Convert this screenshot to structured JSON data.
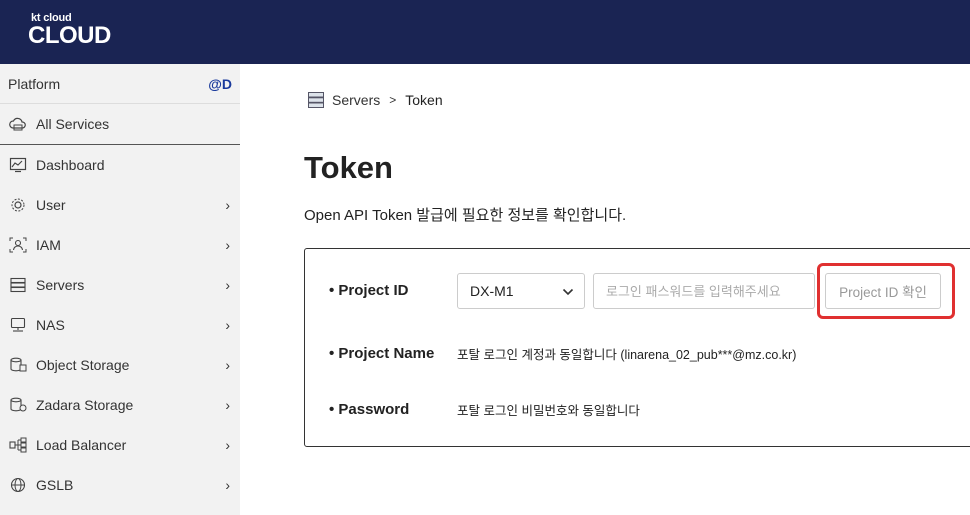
{
  "brand": {
    "small": "kt cloud",
    "big": "CLOUD"
  },
  "sidebar": {
    "header": "Platform",
    "tag": "@D",
    "items": [
      {
        "label": "All Services",
        "icon": "cloud-icon",
        "chevron": ""
      },
      {
        "label": "Dashboard",
        "icon": "dashboard-icon",
        "chevron": "›"
      },
      {
        "label": "User",
        "icon": "user-gear-icon",
        "chevron": "›"
      },
      {
        "label": "IAM",
        "icon": "iam-icon",
        "chevron": "›"
      },
      {
        "label": "Servers",
        "icon": "server-icon",
        "chevron": "›"
      },
      {
        "label": "NAS",
        "icon": "nas-icon",
        "chevron": "›"
      },
      {
        "label": "Object Storage",
        "icon": "object-storage-icon",
        "chevron": "›"
      },
      {
        "label": "Zadara Storage",
        "icon": "zadara-storage-icon",
        "chevron": "›"
      },
      {
        "label": "Load Balancer",
        "icon": "load-balancer-icon",
        "chevron": "›"
      },
      {
        "label": "GSLB",
        "icon": "gslb-icon",
        "chevron": "›"
      }
    ]
  },
  "breadcrumb": {
    "parent": "Servers",
    "sep": ">",
    "current": "Token"
  },
  "page": {
    "title": "Token",
    "description": "Open API Token 발급에 필요한 정보를 확인합니다."
  },
  "form": {
    "project_id_label": "• Project ID",
    "region_select": {
      "value": "DX-M1",
      "chevron": "⌄"
    },
    "password_input": {
      "value": "",
      "placeholder": "로그인 패스워드를 입력해주세요"
    },
    "project_id_button": "Project ID 확인",
    "project_name_label": "• Project Name",
    "project_name_value": "포탈 로그인 계정과 동일합니다 (linarena_02_pub***@mz.co.kr)",
    "password_label": "• Password",
    "password_value": "포탈 로그인 비밀번호와 동일합니다"
  },
  "colors": {
    "topbar": "#1a2453",
    "highlight": "#e03030",
    "tag": "#1a3a9c"
  }
}
